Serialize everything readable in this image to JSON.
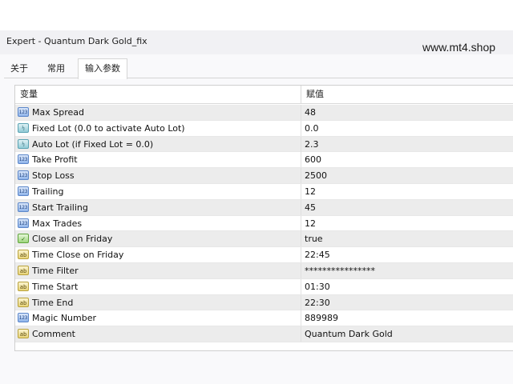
{
  "window": {
    "title": "Expert - Quantum Dark Gold_fix",
    "watermark": "www.mt4.shop"
  },
  "tabs": [
    {
      "label": "关于",
      "active": false
    },
    {
      "label": "常用",
      "active": false
    },
    {
      "label": "输入参数",
      "active": true
    }
  ],
  "grid": {
    "columns": {
      "name": "变量",
      "value": "赋值"
    },
    "rows": [
      {
        "icon": "int-icon",
        "icon_text": "123",
        "name": "Max Spread",
        "value": "48"
      },
      {
        "icon": "double-icon",
        "icon_text": "½",
        "name": "Fixed Lot (0.0 to activate Auto Lot)",
        "value": "0.0"
      },
      {
        "icon": "double-icon",
        "icon_text": "½",
        "name": "Auto Lot (if Fixed Lot = 0.0)",
        "value": "2.3"
      },
      {
        "icon": "int-icon",
        "icon_text": "123",
        "name": "Take Profit",
        "value": "600"
      },
      {
        "icon": "int-icon",
        "icon_text": "123",
        "name": "Stop Loss",
        "value": "2500"
      },
      {
        "icon": "int-icon",
        "icon_text": "123",
        "name": "Trailing",
        "value": "12"
      },
      {
        "icon": "int-icon",
        "icon_text": "123",
        "name": "Start Trailing",
        "value": "45"
      },
      {
        "icon": "int-icon",
        "icon_text": "123",
        "name": "Max Trades",
        "value": "12"
      },
      {
        "icon": "bool-icon",
        "icon_text": "✓",
        "name": "Close all on Friday",
        "value": "true"
      },
      {
        "icon": "string-icon",
        "icon_text": "ab",
        "name": "Time Close on Friday",
        "value": "22:45"
      },
      {
        "icon": "string-icon",
        "icon_text": "ab",
        "name": "Time Filter",
        "value": "****************"
      },
      {
        "icon": "string-icon",
        "icon_text": "ab",
        "name": "Time Start",
        "value": "01:30"
      },
      {
        "icon": "string-icon",
        "icon_text": "ab",
        "name": "Time End",
        "value": "22:30"
      },
      {
        "icon": "int-icon",
        "icon_text": "123",
        "name": "Magic Number",
        "value": "889989"
      },
      {
        "icon": "string-icon",
        "icon_text": "ab",
        "name": "Comment",
        "value": "Quantum Dark Gold"
      }
    ]
  }
}
